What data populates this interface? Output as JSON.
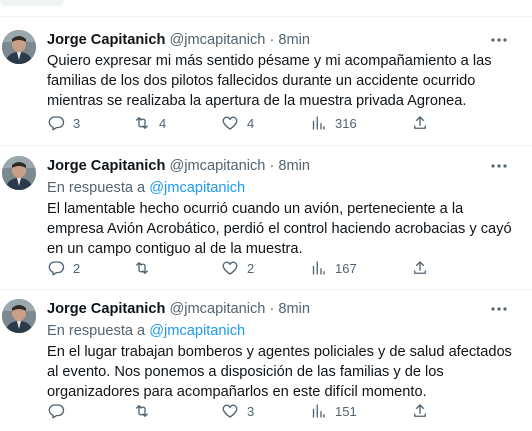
{
  "tweets": [
    {
      "name": "Jorge Capitanich",
      "handle": "@jmcapitanich",
      "separator": "·",
      "time": "8min",
      "reply_label": "",
      "reply_mention": "",
      "text": "Quiero expresar mi más sentido pésame y mi acompañamiento a las familias de los dos pilotos fallecidos durante un accidente ocurrido mientras se realizaba la apertura de la muestra privada Agronea.",
      "replies": "3",
      "retweets": "4",
      "likes": "4",
      "views": "316"
    },
    {
      "name": "Jorge Capitanich",
      "handle": "@jmcapitanich",
      "separator": "·",
      "time": "8min",
      "reply_label": "En respuesta a",
      "reply_mention": "@jmcapitanich",
      "text": "El lamentable hecho ocurrió cuando un avión, perteneciente a la empresa Avión Acrobático, perdió el control haciendo acrobacias y cayó en un campo contiguo al de la muestra.",
      "replies": "2",
      "retweets": "",
      "likes": "2",
      "views": "167"
    },
    {
      "name": "Jorge Capitanich",
      "handle": "@jmcapitanich",
      "separator": "·",
      "time": "8min",
      "reply_label": "En respuesta a",
      "reply_mention": "@jmcapitanich",
      "text": "En el lugar trabajan bomberos y agentes policiales y de salud afectados al evento. Nos ponemos a disposición de las familias y de los organizadores para acompañarlos en este difícil momento.",
      "replies": "",
      "retweets": "",
      "likes": "3",
      "views": "151"
    }
  ],
  "colors": {
    "text": "#0f1419",
    "secondary": "#536471",
    "link": "#1d9bf0",
    "divider": "#eff3f4"
  },
  "icons": [
    "more-icon",
    "reply-icon",
    "retweet-icon",
    "like-icon",
    "views-icon",
    "share-icon"
  ]
}
